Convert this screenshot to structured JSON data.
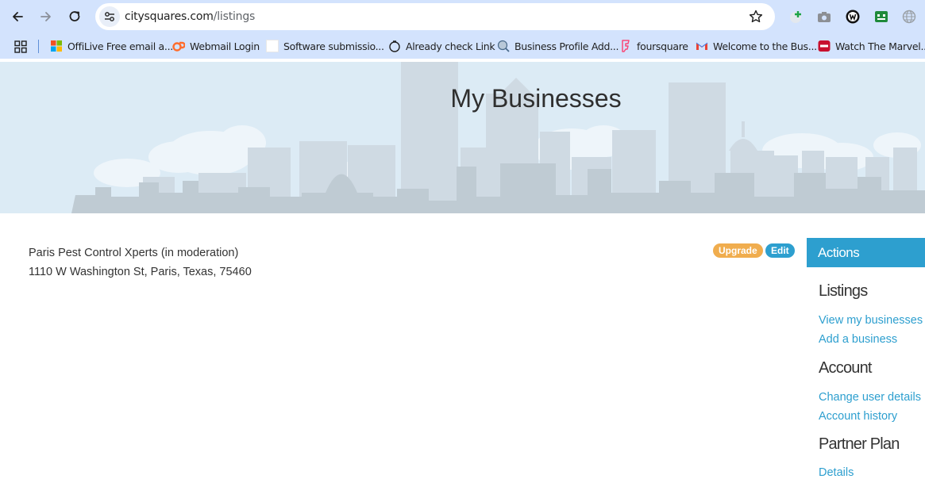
{
  "browser": {
    "url_host": "citysquares.com",
    "url_path": "/listings",
    "bookmarks": [
      {
        "label": "OffiLive Free email a...",
        "icon": "microsoft-icon"
      },
      {
        "label": "Webmail Login",
        "icon": "cpanel-icon"
      },
      {
        "label": "Software submissio...",
        "icon": "blank-page-icon"
      },
      {
        "label": "Already check Link",
        "icon": "timer-icon"
      },
      {
        "label": "Business Profile Add...",
        "icon": "globe-search-icon"
      },
      {
        "label": "foursquare",
        "icon": "foursquare-icon"
      },
      {
        "label": "Welcome to the Bus...",
        "icon": "gmail-icon"
      },
      {
        "label": "Watch The Marvel...",
        "icon": "amc-icon"
      }
    ]
  },
  "hero": {
    "title": "My Businesses"
  },
  "listing": {
    "name": "Paris Pest Control Xperts (in moderation)",
    "address": "1110 W Washington St, Paris, Texas, 75460",
    "upgrade_label": "Upgrade",
    "edit_label": "Edit"
  },
  "sidebar": {
    "header": "Actions",
    "sections": [
      {
        "title": "Listings",
        "links": [
          "View my businesses",
          "Add a business"
        ]
      },
      {
        "title": "Account",
        "links": [
          "Change user details",
          "Account history"
        ]
      },
      {
        "title": "Partner Plan",
        "links": [
          "Details"
        ]
      }
    ]
  },
  "colors": {
    "accent": "#2d9fcf",
    "upgrade": "#f0ad4e",
    "chrome": "#d3e3fd",
    "hero_sky": "#dcebf5"
  }
}
